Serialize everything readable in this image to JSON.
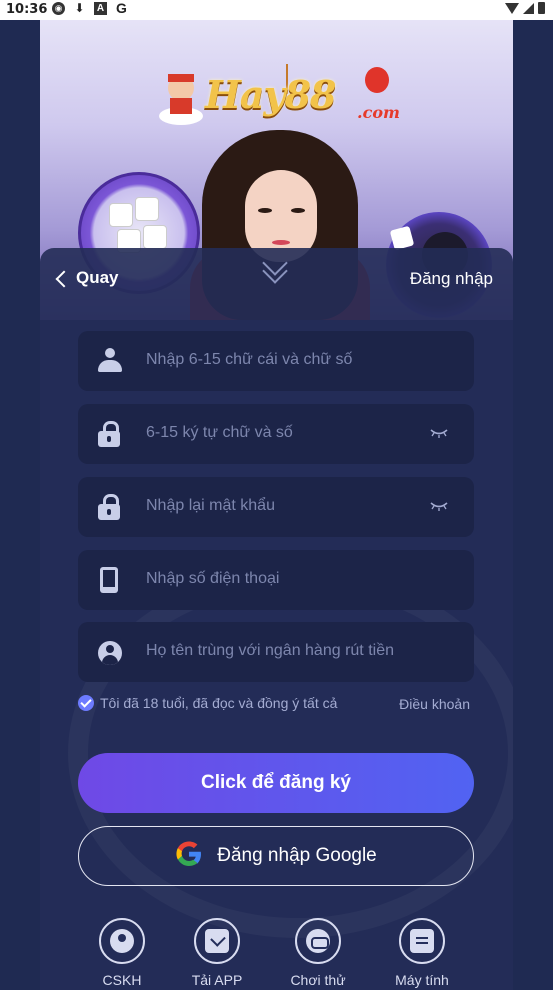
{
  "status_bar": {
    "time": "10:36"
  },
  "hero": {
    "logo_text": "Hay88",
    "logo_suffix": ".com"
  },
  "header": {
    "back_label": "Quay",
    "login_label": "Đăng nhập"
  },
  "form": {
    "username_placeholder": "Nhập 6-15 chữ cái và chữ số",
    "password_placeholder": "6-15 ký tự chữ và số",
    "confirm_password_placeholder": "Nhập lại mật khẩu",
    "phone_placeholder": "Nhập số điện thoại",
    "fullname_placeholder": "Họ tên trùng với ngân hàng rút tiền"
  },
  "agreement": {
    "text": "Tôi đã 18 tuổi, đã đọc và đồng ý tất cả",
    "terms_link": "Điều khoản",
    "checked": true
  },
  "buttons": {
    "register": "Click để đăng ký",
    "google_login": "Đăng nhập Google"
  },
  "bottom_nav": [
    {
      "label": "CSKH",
      "icon": "customer-service-icon"
    },
    {
      "label": "Tải APP",
      "icon": "download-icon"
    },
    {
      "label": "Chơi thử",
      "icon": "gamepad-icon"
    },
    {
      "label": "Máy tính",
      "icon": "message-icon"
    }
  ],
  "colors": {
    "accent": "#5163f2",
    "accent_start": "#6f49e6",
    "sheet": "#232c56",
    "field": "#1c2448"
  }
}
